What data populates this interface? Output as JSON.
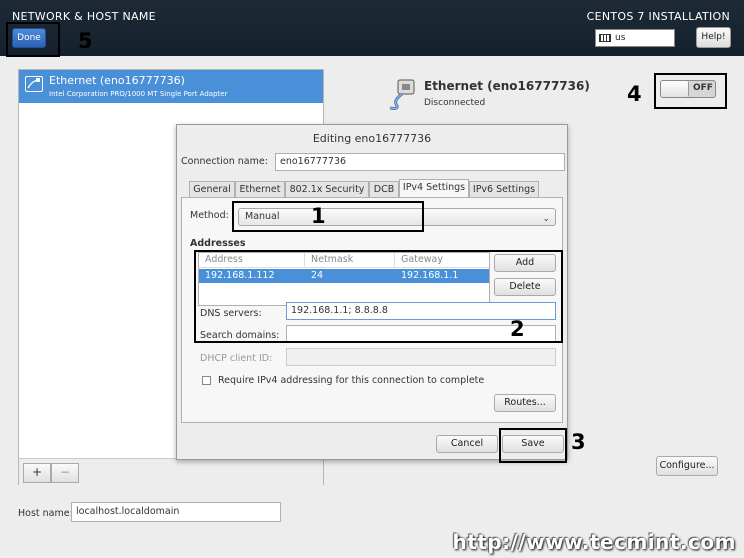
{
  "header": {
    "title": "NETWORK & HOST NAME",
    "installer": "CENTOS 7 INSTALLATION",
    "done_label": "Done",
    "keyboard_layout": "us",
    "help_label": "Help!"
  },
  "connection_list": {
    "items": [
      {
        "name": "Ethernet (eno16777736)",
        "description": "Intel Corporation PRO/1000 MT Single Port Adapter",
        "icon": "ethernet-icon"
      }
    ],
    "add_label": "+",
    "remove_label": "−"
  },
  "device": {
    "title": "Ethernet (eno16777736)",
    "status": "Disconnected",
    "switch_label": "OFF",
    "configure_label": "Configure..."
  },
  "hostname": {
    "label": "Host name:",
    "value": "localhost.localdomain"
  },
  "dialog": {
    "title": "Editing eno16777736",
    "connection_name_label": "Connection name:",
    "connection_name_value": "eno16777736",
    "tabs": [
      "General",
      "Ethernet",
      "802.1x Security",
      "DCB",
      "IPv4 Settings",
      "IPv6 Settings"
    ],
    "active_tab": "IPv4 Settings",
    "method_label": "Method:",
    "method_value": "Manual",
    "addresses_label": "Addresses",
    "columns": [
      "Address",
      "Netmask",
      "Gateway"
    ],
    "rows": [
      {
        "address": "192.168.1.112",
        "netmask": "24",
        "gateway": "192.168.1.1"
      }
    ],
    "add_label": "Add",
    "delete_label": "Delete",
    "dns_label": "DNS servers:",
    "dns_value": "192.168.1.1; 8.8.8.8",
    "search_label": "Search domains:",
    "search_value": "",
    "dhcp_label": "DHCP client ID:",
    "dhcp_value": "",
    "require_label": "Require IPv4 addressing for this connection to complete",
    "routes_label": "Routes...",
    "cancel_label": "Cancel",
    "save_label": "Save"
  },
  "callouts": {
    "c1": "1",
    "c2": "2",
    "c3": "3",
    "c4": "4",
    "c5": "5"
  },
  "watermark": "http://www.tecmint.com",
  "colors": {
    "topbar": "#1d2b3a",
    "selection": "#4a90d9",
    "done_button": "#3a74c8"
  }
}
